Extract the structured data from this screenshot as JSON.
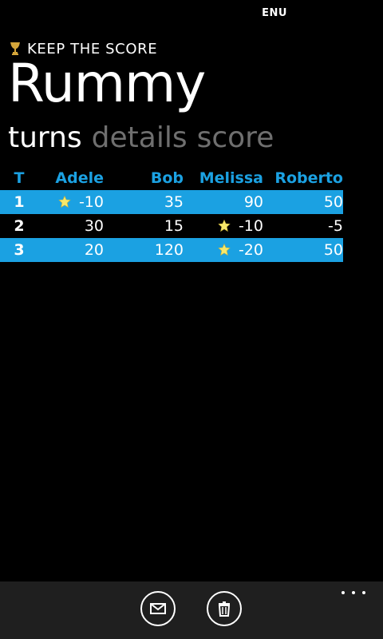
{
  "status_bar": {
    "language": "ENU"
  },
  "header": {
    "app_title": "KEEP THE SCORE",
    "page_title": "Rummy",
    "pivots": [
      {
        "label": "turns",
        "active": true
      },
      {
        "label": "details",
        "active": false
      },
      {
        "label": "score",
        "active": false
      }
    ]
  },
  "table": {
    "turn_header": "T",
    "players": [
      "Adele",
      "Bob",
      "Melissa",
      "Roberto"
    ],
    "rows": [
      {
        "turn": "1",
        "scores": [
          "-10",
          "35",
          "90",
          "50"
        ],
        "winner_index": 0,
        "highlight": true
      },
      {
        "turn": "2",
        "scores": [
          "30",
          "15",
          "-10",
          "-5"
        ],
        "winner_index": 2,
        "highlight": false
      },
      {
        "turn": "3",
        "scores": [
          "20",
          "120",
          "-20",
          "50"
        ],
        "winner_index": 2,
        "highlight": true
      }
    ]
  },
  "app_bar": {
    "buttons": [
      {
        "icon": "mail-icon"
      },
      {
        "icon": "trash-icon"
      }
    ],
    "more_icon": "more-icon"
  },
  "colors": {
    "accent": "#1ba1e2",
    "background": "#000000",
    "app_bar": "#1f1f1f",
    "pivot_inactive": "#6f6f6f",
    "star": "#f7e86a"
  }
}
